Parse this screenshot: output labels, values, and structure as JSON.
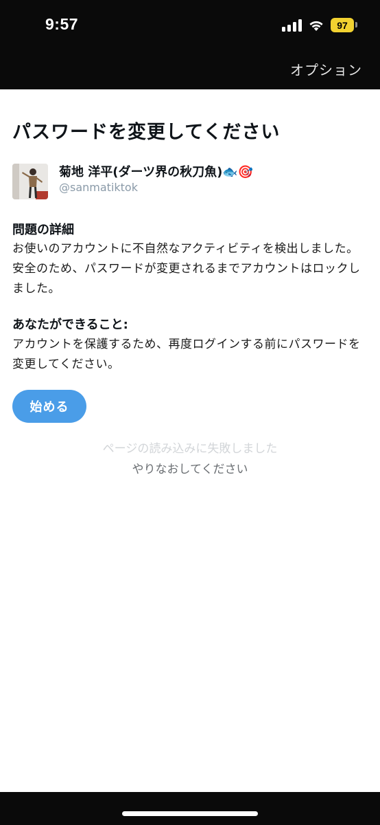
{
  "status_bar": {
    "time": "9:57",
    "battery_level": "97",
    "battery_color": "#f2d230"
  },
  "nav": {
    "options_label": "オプション"
  },
  "page": {
    "title": "パスワードを変更してください"
  },
  "user": {
    "name": "菊地 洋平(ダーツ界の秋刀魚)",
    "name_emoji": "🐟🎯",
    "handle": "@sanmatiktok"
  },
  "problem": {
    "heading": "問題の詳細",
    "body": "お使いのアカウントに不自然なアクティビティを検出しました。安全のため、パスワードが変更されるまでアカウントはロックしました。"
  },
  "action": {
    "heading": "あなたができること:",
    "body": "アカウントを保護するため、再度ログインする前にパスワードを変更してください。"
  },
  "start_button": {
    "label": "始める",
    "color": "#4a9de8"
  },
  "error": {
    "line1": "ページの読み込みに失敗しました",
    "line2": "やりなおしてください"
  }
}
